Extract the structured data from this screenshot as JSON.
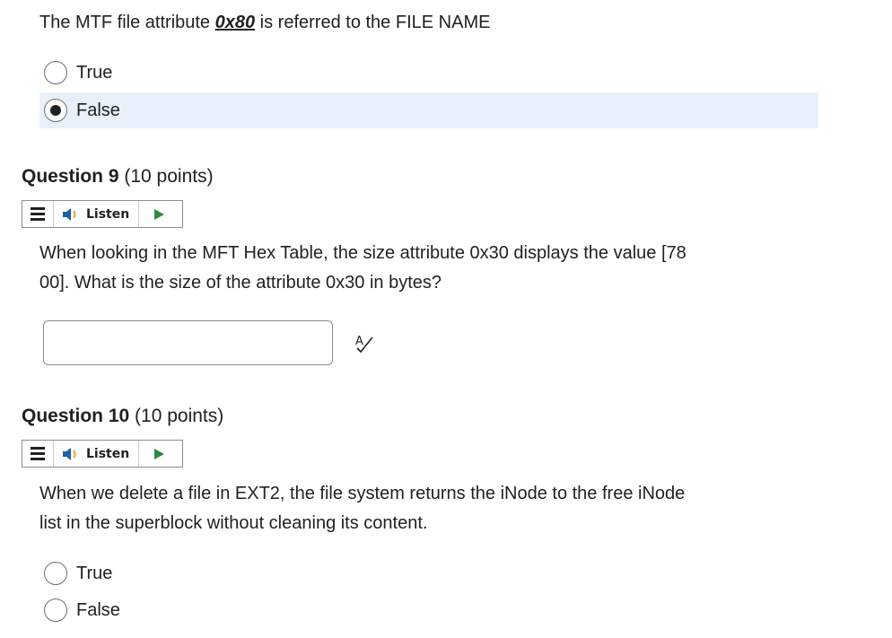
{
  "q8": {
    "text_before": "The MTF file attribute ",
    "attr": "0x80",
    "text_after": " is referred to the FILE NAME",
    "options": [
      "True",
      "False"
    ],
    "selected": "False"
  },
  "q9": {
    "title": "Question 9",
    "points": " (10 points)",
    "listen_label": "Listen",
    "text_line1": "When looking in the MFT Hex Table, the size attribute 0x30 displays the value [78",
    "text_line2": "00]. What is the size of the attribute 0x30 in bytes?",
    "answer_value": "",
    "spellcheck_icon": "spellcheck-icon"
  },
  "q10": {
    "title": "Question 10",
    "points": " (10 points)",
    "listen_label": "Listen",
    "text_line1": "When we delete a file in EXT2, the file system returns the iNode to the free iNode",
    "text_line2": "list in the superblock without cleaning its content.",
    "options": [
      "True",
      "False"
    ],
    "selected": null
  },
  "colors": {
    "selected_bg": "#e8f1fb",
    "play_green": "#2e8b3d",
    "speaker_blue": "#1f5fa8",
    "text": "#202122"
  }
}
